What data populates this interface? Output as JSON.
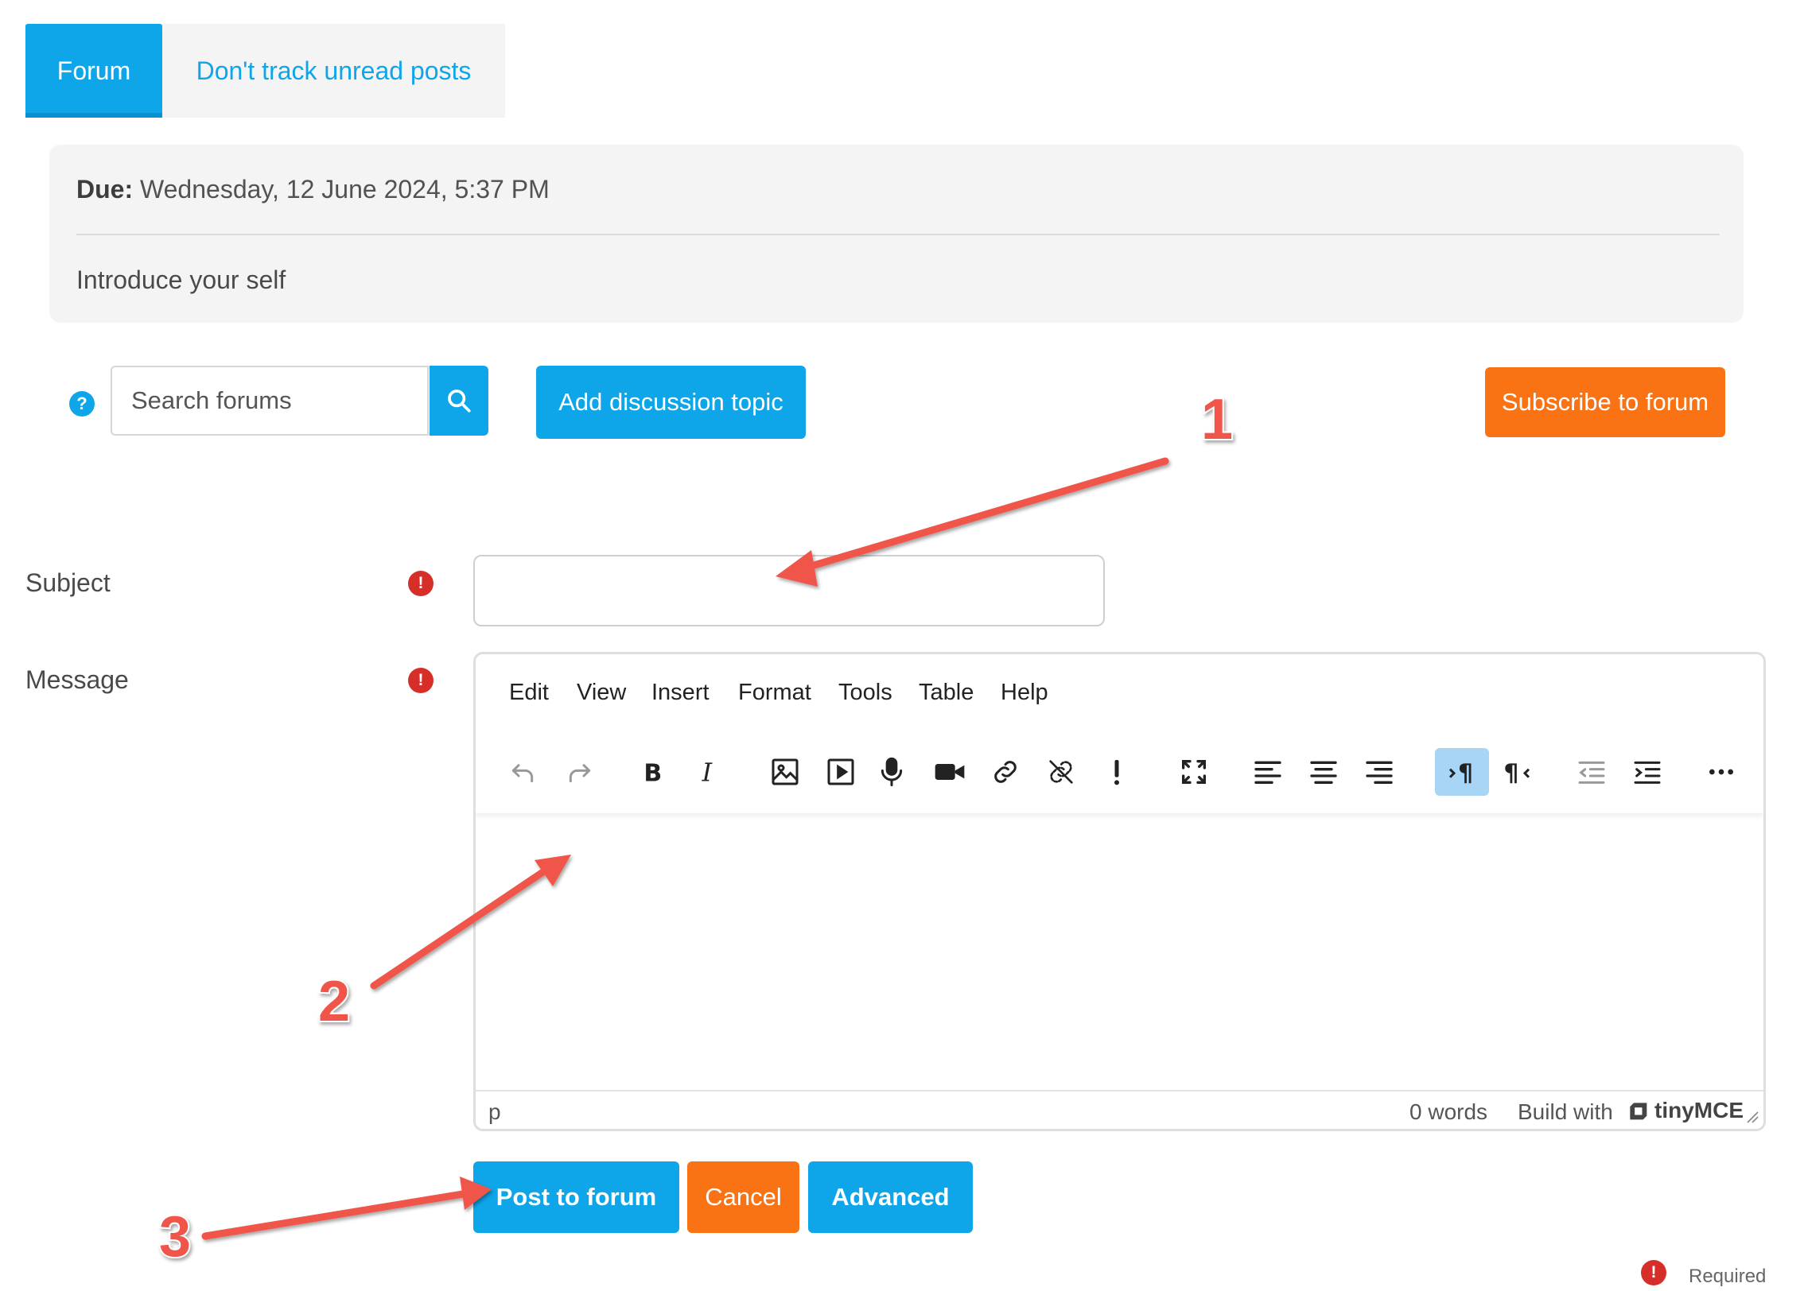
{
  "tabs": [
    {
      "label": "Forum",
      "active": true
    },
    {
      "label": "Don't track unread posts",
      "active": false
    }
  ],
  "info": {
    "due_label": "Due:",
    "due_value": "Wednesday, 12 June 2024, 5:37 PM",
    "description": "Introduce your self"
  },
  "search": {
    "placeholder": "Search forums"
  },
  "actions": {
    "add_topic": "Add discussion topic",
    "subscribe": "Subscribe to forum"
  },
  "form": {
    "subject_label": "Subject",
    "message_label": "Message",
    "subject_value": ""
  },
  "editor": {
    "menu": [
      "Edit",
      "View",
      "Insert",
      "Format",
      "Tools",
      "Table",
      "Help"
    ],
    "toolbar_icons": [
      "undo-icon",
      "redo-icon",
      "bold-icon",
      "italic-icon",
      "image-icon",
      "media-icon",
      "microphone-icon",
      "video-camera-icon",
      "link-icon",
      "unlink-icon",
      "exclamation-icon",
      "fullscreen-icon",
      "align-left-icon",
      "align-center-icon",
      "align-right-icon",
      "ltr-icon",
      "rtl-icon",
      "outdent-icon",
      "indent-icon",
      "more-icon"
    ],
    "status_path": "p",
    "word_count": "0 words",
    "build_with": "Build with",
    "brand": "tinyMCE"
  },
  "buttons": {
    "post": "Post to forum",
    "cancel": "Cancel",
    "advanced": "Advanced"
  },
  "required_note": "Required",
  "annotations": [
    "1",
    "2",
    "3"
  ],
  "colors": {
    "primary": "#0fa5e9",
    "orange": "#f97314",
    "required": "#d62f2a",
    "arrow": "#f0544a"
  }
}
